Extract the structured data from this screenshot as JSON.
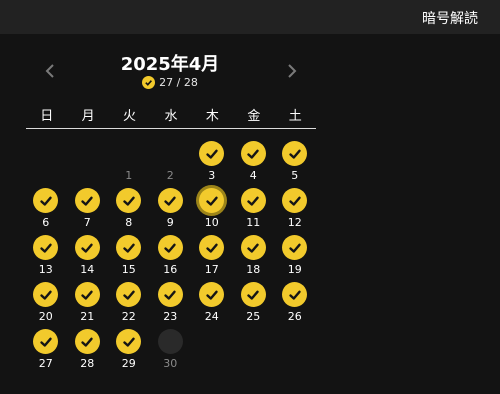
{
  "app_title": "暗号解読",
  "calendar": {
    "month_title": "2025年4月",
    "progress": "27 / 28",
    "weekdays": [
      "日",
      "月",
      "火",
      "水",
      "木",
      "金",
      "土"
    ],
    "leading_blanks": 2,
    "days": [
      {
        "n": "1",
        "state": "none"
      },
      {
        "n": "2",
        "state": "none"
      },
      {
        "n": "3",
        "state": "done"
      },
      {
        "n": "4",
        "state": "done"
      },
      {
        "n": "5",
        "state": "done"
      },
      {
        "n": "6",
        "state": "done"
      },
      {
        "n": "7",
        "state": "done"
      },
      {
        "n": "8",
        "state": "done"
      },
      {
        "n": "9",
        "state": "done"
      },
      {
        "n": "10",
        "state": "today"
      },
      {
        "n": "11",
        "state": "done"
      },
      {
        "n": "12",
        "state": "done"
      },
      {
        "n": "13",
        "state": "done"
      },
      {
        "n": "14",
        "state": "done"
      },
      {
        "n": "15",
        "state": "done"
      },
      {
        "n": "16",
        "state": "done"
      },
      {
        "n": "17",
        "state": "done"
      },
      {
        "n": "18",
        "state": "done"
      },
      {
        "n": "19",
        "state": "done"
      },
      {
        "n": "20",
        "state": "done"
      },
      {
        "n": "21",
        "state": "done"
      },
      {
        "n": "22",
        "state": "done"
      },
      {
        "n": "23",
        "state": "done"
      },
      {
        "n": "24",
        "state": "done"
      },
      {
        "n": "25",
        "state": "done"
      },
      {
        "n": "26",
        "state": "done"
      },
      {
        "n": "27",
        "state": "done"
      },
      {
        "n": "28",
        "state": "done"
      },
      {
        "n": "29",
        "state": "done"
      },
      {
        "n": "30",
        "state": "empty"
      }
    ]
  },
  "colors": {
    "accent": "#f2ca2c",
    "today_ring": "#9c8419",
    "background": "#131313",
    "topbar": "#222222"
  }
}
